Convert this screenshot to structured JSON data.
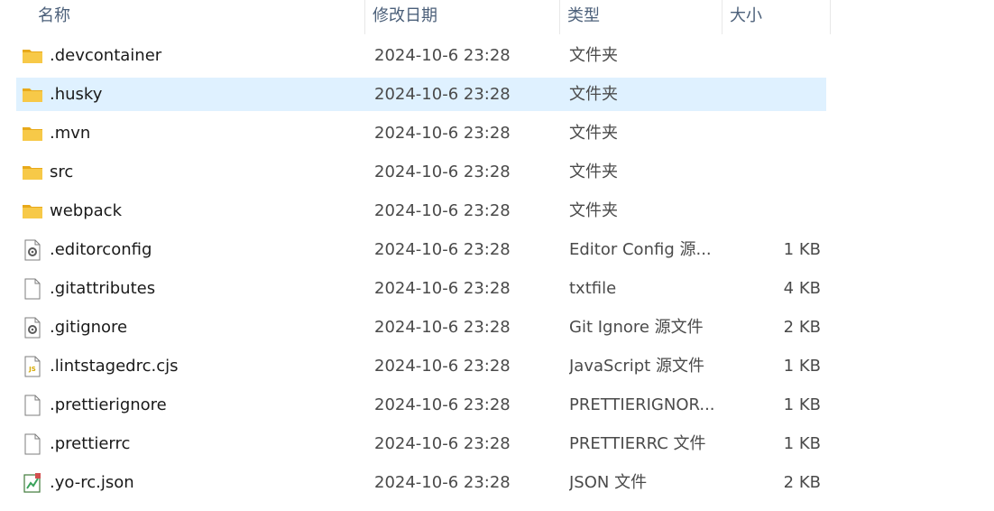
{
  "columns": {
    "name": "名称",
    "date": "修改日期",
    "type": "类型",
    "size": "大小"
  },
  "files": [
    {
      "name": ".devcontainer",
      "date": "2024-10-6 23:28",
      "type": "文件夹",
      "size": "",
      "icon": "folder-icon"
    },
    {
      "name": ".husky",
      "date": "2024-10-6 23:28",
      "type": "文件夹",
      "size": "",
      "icon": "folder-icon",
      "selected": true
    },
    {
      "name": ".mvn",
      "date": "2024-10-6 23:28",
      "type": "文件夹",
      "size": "",
      "icon": "folder-icon"
    },
    {
      "name": "src",
      "date": "2024-10-6 23:28",
      "type": "文件夹",
      "size": "",
      "icon": "folder-icon"
    },
    {
      "name": "webpack",
      "date": "2024-10-6 23:28",
      "type": "文件夹",
      "size": "",
      "icon": "folder-icon"
    },
    {
      "name": ".editorconfig",
      "date": "2024-10-6 23:28",
      "type": "Editor Config 源...",
      "size": "1 KB",
      "icon": "settings-file-icon"
    },
    {
      "name": ".gitattributes",
      "date": "2024-10-6 23:28",
      "type": "txtfile",
      "size": "4 KB",
      "icon": "blank-file-icon"
    },
    {
      "name": ".gitignore",
      "date": "2024-10-6 23:28",
      "type": "Git Ignore 源文件",
      "size": "2 KB",
      "icon": "settings-file-icon"
    },
    {
      "name": ".lintstagedrc.cjs",
      "date": "2024-10-6 23:28",
      "type": "JavaScript 源文件",
      "size": "1 KB",
      "icon": "js-file-icon"
    },
    {
      "name": ".prettierignore",
      "date": "2024-10-6 23:28",
      "type": "PRETTIERIGNOR...",
      "size": "1 KB",
      "icon": "blank-file-icon"
    },
    {
      "name": ".prettierrc",
      "date": "2024-10-6 23:28",
      "type": "PRETTIERRC 文件",
      "size": "1 KB",
      "icon": "blank-file-icon"
    },
    {
      "name": ".yo-rc.json",
      "date": "2024-10-6 23:28",
      "type": "JSON 文件",
      "size": "2 KB",
      "icon": "json-file-icon"
    }
  ],
  "colors": {
    "selected_row": "#dff1ff",
    "folder": "#f5c443",
    "header_text": "#4c607a"
  }
}
